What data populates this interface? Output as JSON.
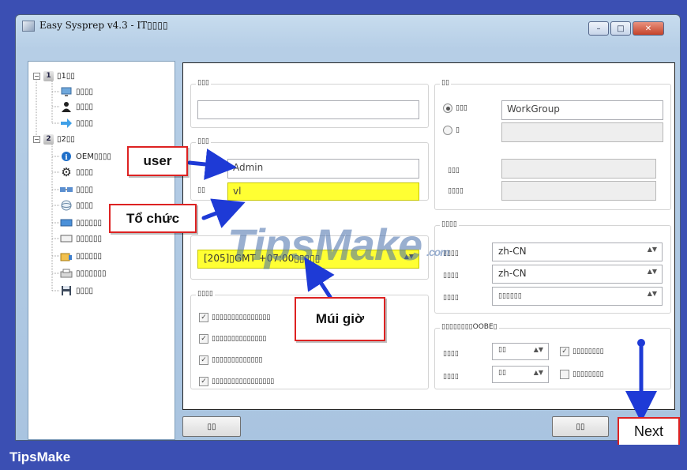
{
  "window": {
    "title": "Easy Sysprep v4.3 - IT▯▯▯▯",
    "minimize": "–",
    "maximize": "□",
    "close": "✕"
  },
  "tree": {
    "step1": {
      "num": "1",
      "label": "▯1▯▯"
    },
    "step1_items": [
      "▯▯▯▯",
      "▯▯▯▯",
      "▯▯▯▯"
    ],
    "step2": {
      "num": "2",
      "label": "▯2▯▯"
    },
    "step2_items": [
      "OEM▯▯▯▯",
      "▯▯▯▯",
      "▯▯▯▯",
      "▯▯▯▯",
      "▯▯▯▯▯▯",
      "▯▯▯▯▯▯",
      "▯▯▯▯▯▯",
      "▯▯▯▯▯▯▯",
      "▯▯▯▯"
    ]
  },
  "form": {
    "group1_label": "▯▯▯",
    "group2_label": "▯▯▯",
    "user_value": "Admin",
    "org_label": "▯▯",
    "org_value": "vl",
    "timezone_value": "[205]▯GMT +07:00▯▯▯▯▯",
    "options_label": "▯▯▯▯",
    "options": [
      "▯▯▯▯▯▯▯▯▯▯▯▯▯▯▯",
      "▯▯▯▯▯▯▯▯▯▯▯▯▯▯",
      "▯▯▯▯▯▯▯▯▯▯▯▯▯",
      "▯▯▯▯▯▯▯▯▯▯▯▯▯▯▯▯"
    ],
    "network_label": "▯▯",
    "workgroup_radio": "▯▯▯",
    "workgroup_value": "WorkGroup",
    "domain_radio": "▯",
    "net_field1": "▯▯▯",
    "net_field2": "▯▯▯▯",
    "region_label": "▯▯▯▯",
    "region_rows": [
      {
        "label": "▯▯▯▯",
        "value": "zh-CN"
      },
      {
        "label": "▯▯▯▯",
        "value": "zh-CN"
      },
      {
        "label": "▯▯▯▯",
        "value": "▯▯▯▯▯▯"
      }
    ],
    "oobe_label": "▯▯▯▯▯▯▯▯OOBE▯",
    "oobe_rows": [
      {
        "label": "▯▯▯▯",
        "select": "▯▯",
        "check_label": "▯▯▯▯▯▯▯▯",
        "checked": true
      },
      {
        "label": "▯▯▯▯",
        "select": "▯▯",
        "check_label": "▯▯▯▯▯▯▯▯",
        "checked": false
      }
    ],
    "back_button": "▯▯",
    "next_small_button": "▯▯"
  },
  "annotations": {
    "user": "user",
    "org": "Tổ chức",
    "timezone": "Múi giờ",
    "next": "Next"
  },
  "watermark": {
    "main": "TipsMake",
    "suffix": ".com"
  },
  "footer": {
    "brand": "TipsMake"
  },
  "colors": {
    "annotation_border": "#d22222",
    "arrow": "#1e3ad6",
    "highlight": "#ffff33",
    "background": "#3b4fb3"
  }
}
